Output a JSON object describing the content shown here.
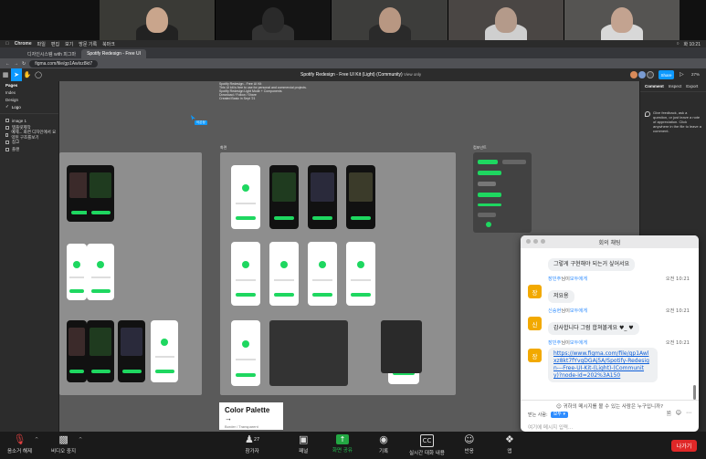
{
  "zoom": {
    "video_tiles": [
      {
        "bg": "#3a3a36",
        "face": "#c9a58c",
        "body": "#222"
      },
      {
        "bg": "#141414",
        "face": "#2a2a2a",
        "body": "#333"
      },
      {
        "bg": "#3d3d3b",
        "face": "#b89782",
        "body": "#2a2a2a"
      },
      {
        "bg": "#4a4644",
        "face": "#b49a8a",
        "body": "#cfcfcf"
      },
      {
        "bg": "#555452",
        "face": "#c3a390",
        "body": "#d8d8d8"
      }
    ],
    "toolbar": {
      "mute_label": "음소거 해제",
      "video_label": "비디오 중지",
      "participants_label": "참가자",
      "participants_count": "27",
      "poll_label": "패널",
      "share_label": "화면 공유",
      "record_label": "기록",
      "cc_label": "실시간 대화 내용",
      "reactions_label": "반응",
      "apps_label": "앱",
      "leave_label": "나가기"
    },
    "chat": {
      "title": "회의 채팅",
      "first_message": "그렇게 구현해야 되는거 싶어서요",
      "messages": [
        {
          "avatar": "장",
          "sender": "장민주",
          "connector": "님이",
          "target": "모두에게",
          "time": "오전 10:21",
          "text": "저요용",
          "is_link": false
        },
        {
          "avatar": "신",
          "sender": "신승현",
          "connector": "님이",
          "target": "모두에게",
          "time": "오전 10:21",
          "text": "감사합니다 그럼 합쳐볼게요 ♥_ ♥",
          "is_link": false
        },
        {
          "avatar": "장",
          "sender": "장민주",
          "connector": "님이",
          "target": "모두에게",
          "time": "오전 10:21",
          "text": "https://www.figma.com/file/gp1Awlxz8kt7fYvgDGAj5A/Spotify-Redesign---Free-UI-Kit-(Light)-(Community)?node-id=202%3A150",
          "is_link": true
        }
      ],
      "who_can_see": "귀하의 메시지를 볼 수 있는 사람은 누구입니까?",
      "to_label": "받는 사람:",
      "to_value": "모두",
      "input_placeholder": "여기에 메시지 입력..."
    }
  },
  "menubar": {
    "app": "Chrome",
    "items": [
      "파일",
      "편집",
      "보기",
      "방문 기록",
      "북마크"
    ],
    "clock": "화 10:21"
  },
  "browser": {
    "tabs": [
      "디자인시스템 with 피그마",
      "Spotify Redesign - Free UI"
    ],
    "url": "figma.com/file/gp1Awlxz8kt7"
  },
  "figma": {
    "file_title": "Spotify Redesign - Free UI Kit (Light) (Community)",
    "view_only": "View only",
    "share_label": "Share",
    "zoom_level": "27%",
    "left_panel": {
      "pages_header": "Pages",
      "pages": [
        "Index",
        "Design",
        "Logo"
      ],
      "layers": [
        "image 1",
        "템플릿제작",
        "예제... 화면 디자인에서 요약된 구조를보기",
        "참고",
        "플랜"
      ]
    },
    "right_panel": {
      "tabs": [
        "Comment",
        "Inspect",
        "Export"
      ],
      "hint": "Give feedback, ask a question, or just leave a note of appreciation. Click anywhere in the file to leave a comment."
    },
    "canvas": {
      "cursor_name": "이은정",
      "board_label_main": "화면",
      "board_label_comp": "컴포넌트",
      "palette_title": "Color Palette →",
      "palette_subtitle": "Border / Transparent",
      "notes": "Spotify Redesign - Free UI Kit\nThis UI kit is free to use for personal and commercial projects.\nSpotify Redesign Light Mode + Components\nDownload / Follow / Share\nCreated Basic in Sept '21"
    },
    "colors": {
      "accent": "#0d99ff",
      "spotify_green": "#1ed760"
    }
  }
}
